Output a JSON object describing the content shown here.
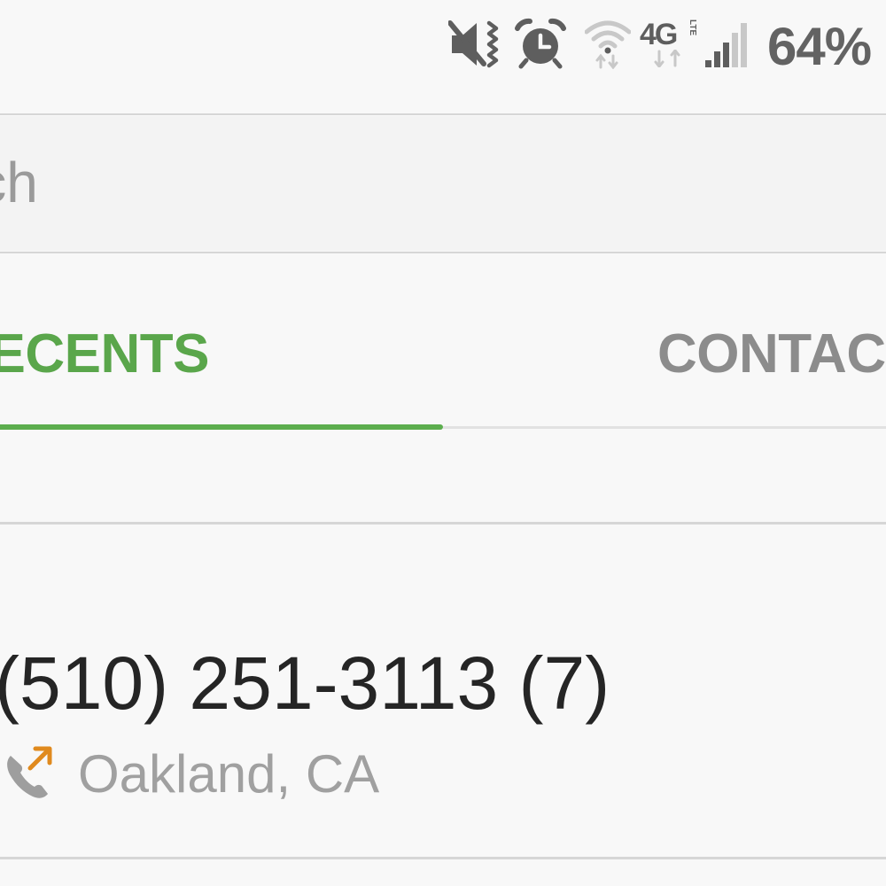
{
  "status_bar": {
    "battery_percent": "64%",
    "icons": [
      "vibrate-mute-icon",
      "alarm-icon",
      "wifi-icon",
      "4g-lte-icon",
      "signal-icon"
    ],
    "network_label": "4G",
    "network_sub": "LTE"
  },
  "search": {
    "placeholder": "Search"
  },
  "tabs": [
    {
      "label": "RECENTS",
      "active": true
    },
    {
      "label": "CONTACTS",
      "active": false
    }
  ],
  "recents": [
    {
      "number": "(510) 251-3113 (7)",
      "location": "Oakland, CA",
      "call_type_icon": "outgoing-call-icon"
    }
  ],
  "colors": {
    "accent": "#5aa64b",
    "background": "#f8f8f8",
    "outgoing_arrow": "#e08a1e"
  }
}
